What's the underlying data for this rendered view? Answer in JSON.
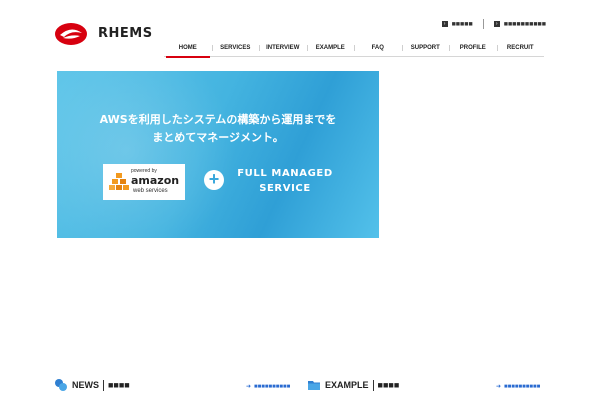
{
  "brand": {
    "name": "RHEMS"
  },
  "utility_links": [
    {
      "label": "■■■■■"
    },
    {
      "label": "■■■■■■■■■■"
    }
  ],
  "nav": [
    {
      "label": "HOME",
      "active": true
    },
    {
      "label": "SERVICES"
    },
    {
      "label": "INTERVIEW"
    },
    {
      "label": "EXAMPLE"
    },
    {
      "label": "FAQ"
    },
    {
      "label": "SUPPORT"
    },
    {
      "label": "PROFILE"
    },
    {
      "label": "RECRUIT"
    }
  ],
  "hero": {
    "line1": "AWSを利用したシステムの構築から運用までを",
    "line2": "まとめてマネージメント。",
    "aws_powered": "powered by",
    "aws_name": "amazon",
    "aws_sub": "web services",
    "plus": "+",
    "managed_line1": "FULL MANAGED",
    "managed_line2": "SERVICE"
  },
  "news": {
    "title": "NEWS",
    "sub": "■■■■",
    "more": "■■■■■■■■■■"
  },
  "example": {
    "title": "EXAMPLE",
    "sub": "■■■■",
    "more": "■■■■■■■■■■"
  },
  "colors": {
    "accent": "#d7000f",
    "hero": "#44b4e0",
    "link": "#2a6bd1"
  }
}
